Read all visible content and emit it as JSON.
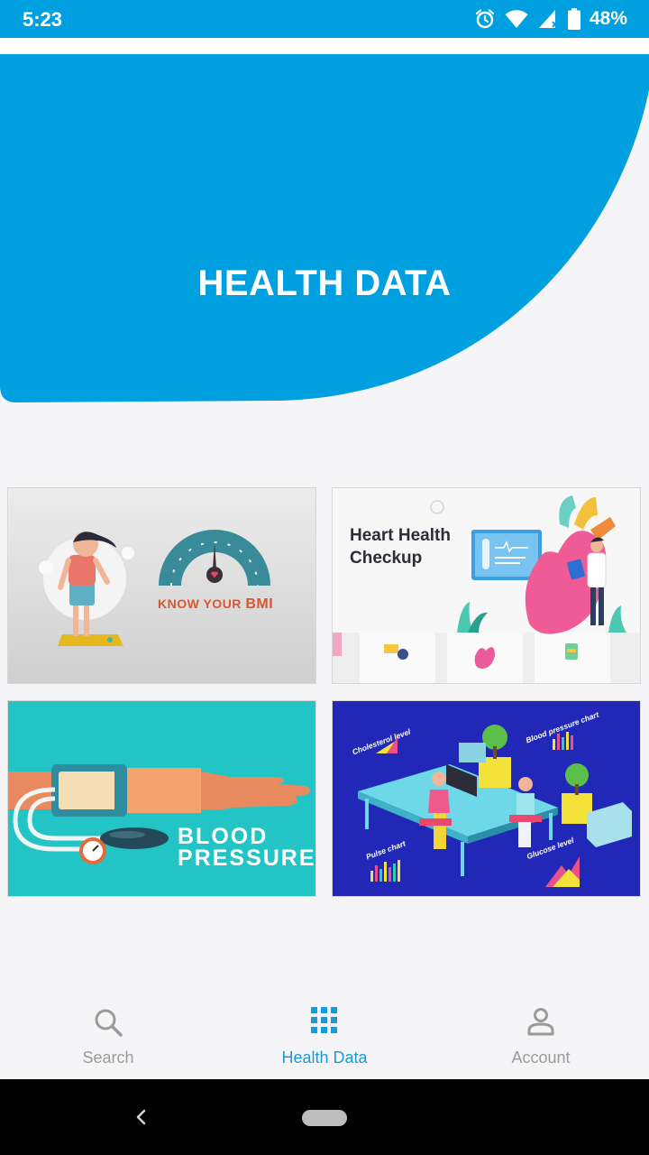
{
  "status_bar": {
    "time": "5:23",
    "battery": "48%",
    "background": "#00a0e0",
    "icons": [
      "alarm-icon",
      "wifi-icon",
      "signal-icon",
      "battery-icon"
    ]
  },
  "hero": {
    "title": "HEALTH DATA",
    "color": "#00a0e0"
  },
  "cards": {
    "bmi": {
      "text_prefix": "KNOW YOUR ",
      "text_emphasis": "BMI"
    },
    "heart": {
      "title_line1": "Heart Health",
      "title_line2": "Checkup"
    },
    "blood_pressure": {
      "line1": "BLOOD",
      "line2": "PRESSURE"
    },
    "statistics": {
      "labels": [
        "Cholesterol level",
        "Blood pressure chart",
        "Pulse chart",
        "Glucose level"
      ]
    }
  },
  "bottom_nav": {
    "items": [
      {
        "label": "Search",
        "icon": "search-icon",
        "active": false
      },
      {
        "label": "Health Data",
        "icon": "grid-icon",
        "active": true
      },
      {
        "label": "Account",
        "icon": "person-icon",
        "active": false
      }
    ],
    "active_color": "#1a9bd7",
    "inactive_color": "#9a9a9a"
  },
  "system_nav": {
    "icons": [
      "back-icon",
      "home-icon"
    ]
  }
}
